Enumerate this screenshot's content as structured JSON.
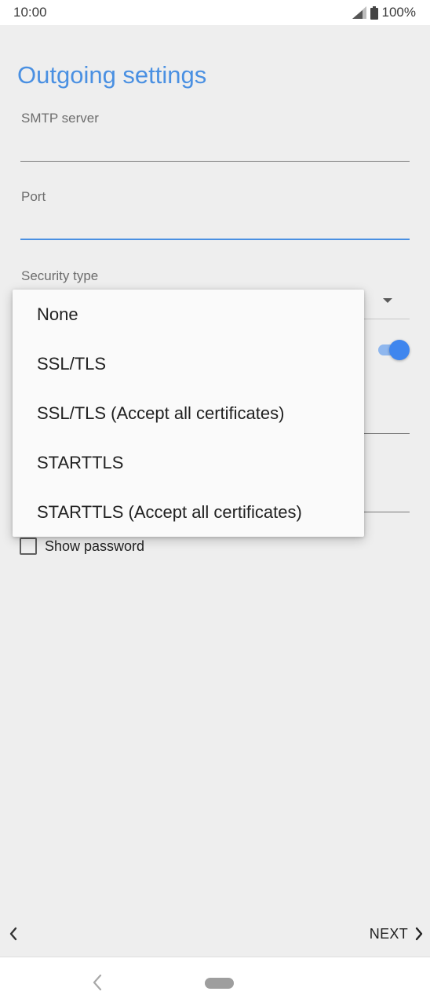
{
  "status_bar": {
    "time": "10:00",
    "battery": "100%",
    "signal_icon": "signal-icon",
    "battery_icon": "battery-icon"
  },
  "page": {
    "title": "Outgoing settings"
  },
  "fields": {
    "smtp_server": {
      "label": "SMTP server",
      "value": ""
    },
    "port": {
      "label": "Port",
      "value": ""
    },
    "security_type": {
      "label": "Security type"
    }
  },
  "dropdown": {
    "options": [
      "None",
      "SSL/TLS",
      "SSL/TLS (Accept all certificates)",
      "STARTTLS",
      "STARTTLS (Accept all certificates)"
    ]
  },
  "toggle": {
    "state": "on",
    "accent_color": "#3f86ee"
  },
  "show_password": {
    "label": "Show password",
    "checked": false
  },
  "navigation": {
    "next_label": "NEXT",
    "back_icon": "chevron-left-icon",
    "next_icon": "chevron-right-icon"
  },
  "colors": {
    "accent": "#4a90e2",
    "background": "#eeeeee"
  }
}
